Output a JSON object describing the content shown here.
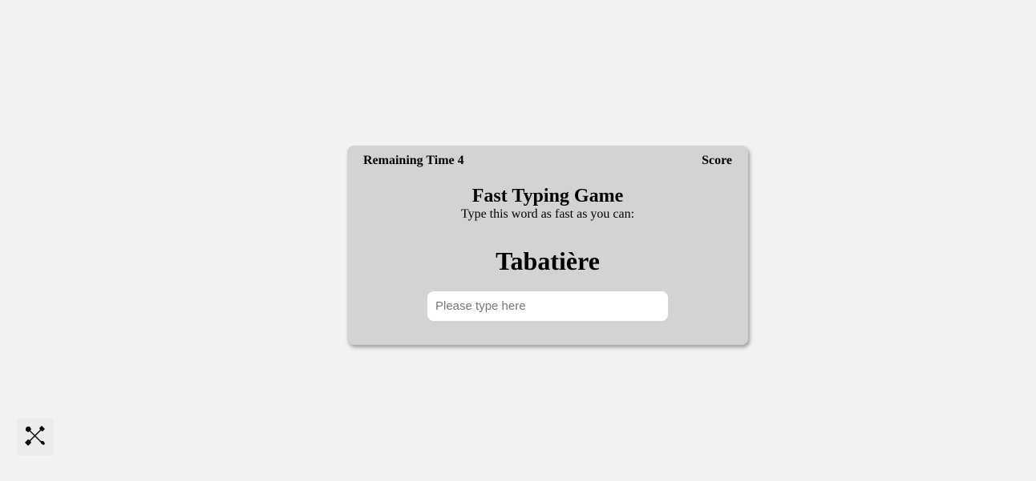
{
  "game": {
    "remaining_time": "Remaining Time 4",
    "score": "Score",
    "title": "Fast Typing Game",
    "subtitle": "Type this word as fast as you can:",
    "word": "Tabatière",
    "input_placeholder": "Please type here",
    "input_value": ""
  },
  "tools": {
    "icon": "tools-icon"
  },
  "colors": {
    "background": "#f2f2f2",
    "card": "#d3d3d3",
    "input": "#ffffff"
  }
}
